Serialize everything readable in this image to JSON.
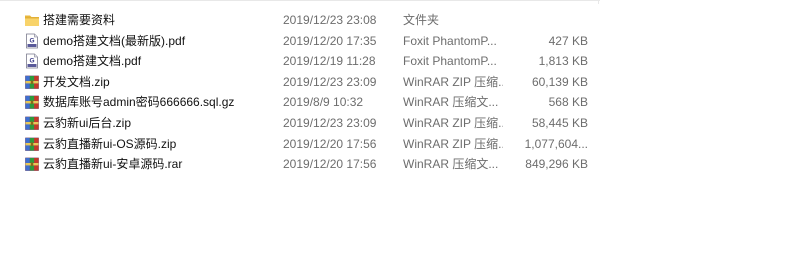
{
  "files": [
    {
      "name": "搭建需要资料",
      "date": "2019/12/23 23:08",
      "type": "文件夹",
      "size": "",
      "icon": "folder-icon"
    },
    {
      "name": "demo搭建文档(最新版).pdf",
      "date": "2019/12/20 17:35",
      "type": "Foxit PhantomP...",
      "size": "427 KB",
      "icon": "pdf-icon"
    },
    {
      "name": "demo搭建文档.pdf",
      "date": "2019/12/19 11:28",
      "type": "Foxit PhantomP...",
      "size": "1,813 KB",
      "icon": "pdf-icon"
    },
    {
      "name": "开发文档.zip",
      "date": "2019/12/23 23:09",
      "type": "WinRAR ZIP 压缩...",
      "size": "60,139 KB",
      "icon": "winrar-archive-icon"
    },
    {
      "name": "数据库账号admin密码666666.sql.gz",
      "date": "2019/8/9 10:32",
      "type": "WinRAR 压缩文...",
      "size": "568 KB",
      "icon": "winrar-archive-icon"
    },
    {
      "name": "云豹新ui后台.zip",
      "date": "2019/12/23 23:09",
      "type": "WinRAR ZIP 压缩...",
      "size": "58,445 KB",
      "icon": "winrar-archive-icon"
    },
    {
      "name": "云豹直播新ui-OS源码.zip",
      "date": "2019/12/20 17:56",
      "type": "WinRAR ZIP 压缩...",
      "size": "1,077,604...",
      "icon": "winrar-archive-icon"
    },
    {
      "name": "云豹直播新ui-安卓源码.rar",
      "date": "2019/12/20 17:56",
      "type": "WinRAR 压缩文...",
      "size": "849,296 KB",
      "icon": "winrar-archive-icon"
    }
  ]
}
